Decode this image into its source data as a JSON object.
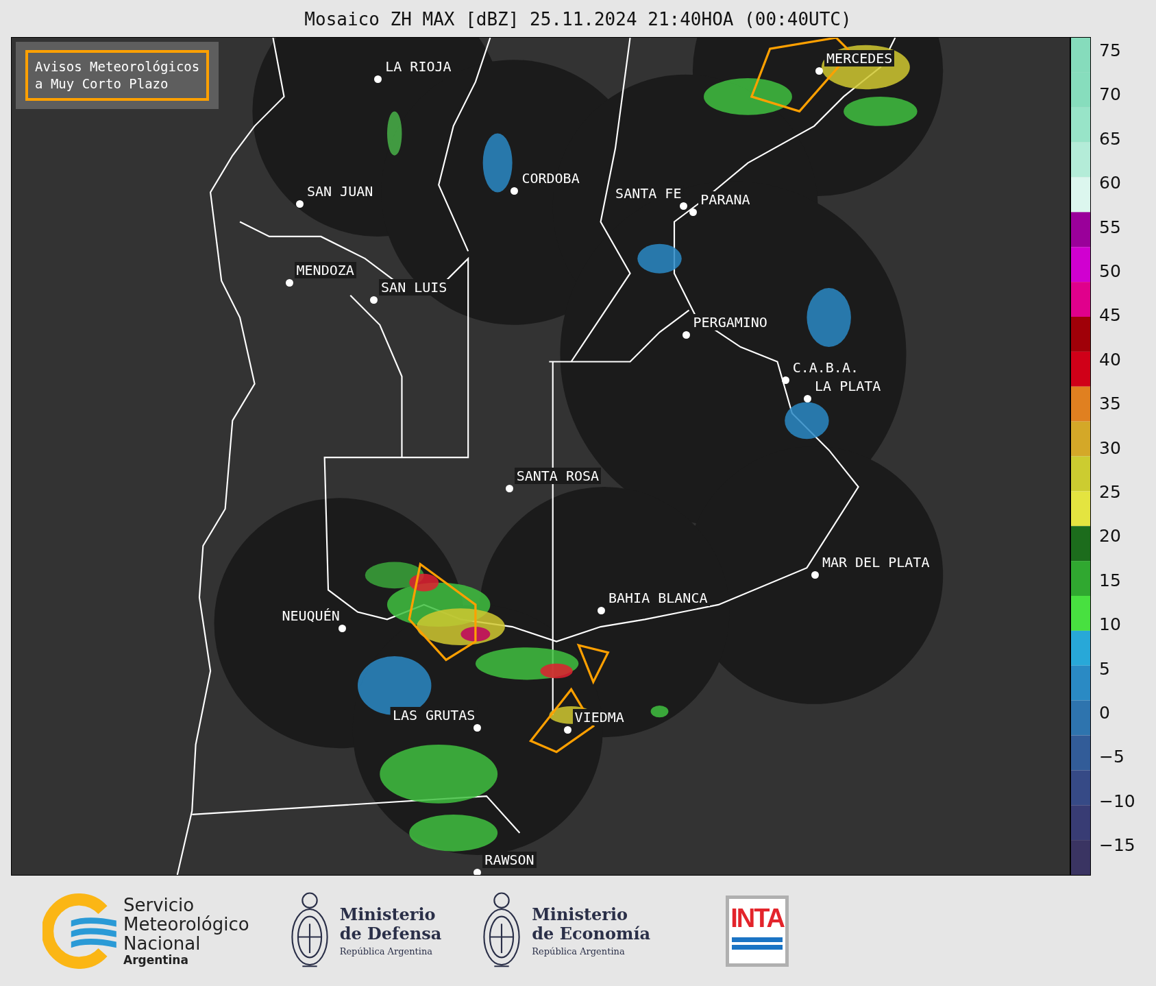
{
  "title": "Mosaico ZH MAX [dBZ] 25.11.2024 21:40HOA (00:40UTC)",
  "legend": {
    "lines": [
      "Avisos Meteorológicos",
      "a Muy Corto Plazo"
    ]
  },
  "cities": [
    {
      "name": "LA RIOJA"
    },
    {
      "name": "CORDOBA"
    },
    {
      "name": "SAN JUAN"
    },
    {
      "name": "SANTA FE"
    },
    {
      "name": "PARANA"
    },
    {
      "name": "MENDOZA"
    },
    {
      "name": "SAN LUIS"
    },
    {
      "name": "PERGAMINO"
    },
    {
      "name": "MERCEDES"
    },
    {
      "name": "C.A.B.A."
    },
    {
      "name": "LA PLATA"
    },
    {
      "name": "SANTA ROSA"
    },
    {
      "name": "MAR DEL PLATA"
    },
    {
      "name": "BAHIA BLANCA"
    },
    {
      "name": "NEUQUÉN"
    },
    {
      "name": "LAS GRUTAS"
    },
    {
      "name": "VIEDMA"
    },
    {
      "name": "RAWSON"
    }
  ],
  "colorbar": {
    "ticks": [
      "75",
      "70",
      "65",
      "60",
      "55",
      "50",
      "45",
      "40",
      "35",
      "30",
      "25",
      "20",
      "15",
      "10",
      "5",
      "0",
      "−5",
      "−10",
      "−15"
    ],
    "bands": [
      {
        "color": "#86dcbc"
      },
      {
        "color": "#87ddbd"
      },
      {
        "color": "#98e4c8"
      },
      {
        "color": "#b4ecd8"
      },
      {
        "color": "#dcf6ee"
      },
      {
        "color": "#9a009a"
      },
      {
        "color": "#d000d0"
      },
      {
        "color": "#e0008c"
      },
      {
        "color": "#a00008"
      },
      {
        "color": "#d00018"
      },
      {
        "color": "#e08020"
      },
      {
        "color": "#d4a828"
      },
      {
        "color": "#cccc30"
      },
      {
        "color": "#e4e440"
      },
      {
        "color": "#1c6c1c"
      },
      {
        "color": "#30a830"
      },
      {
        "color": "#48e040"
      },
      {
        "color": "#28a8d8"
      },
      {
        "color": "#2a8ac4"
      },
      {
        "color": "#2e74ae"
      },
      {
        "color": "#325c98"
      },
      {
        "color": "#364a86"
      },
      {
        "color": "#383c74"
      },
      {
        "color": "#3a3462"
      }
    ]
  },
  "footer": {
    "smn": {
      "lines": [
        "Servicio",
        "Meteorológico",
        "Nacional"
      ],
      "country": "Argentina"
    },
    "ministries": [
      {
        "line1": "Ministerio",
        "line2": "de Defensa",
        "country": "República Argentina"
      },
      {
        "line1": "Ministerio",
        "line2": "de Economía",
        "country": "República Argentina"
      }
    ],
    "inta": {
      "text": "INTA"
    }
  }
}
